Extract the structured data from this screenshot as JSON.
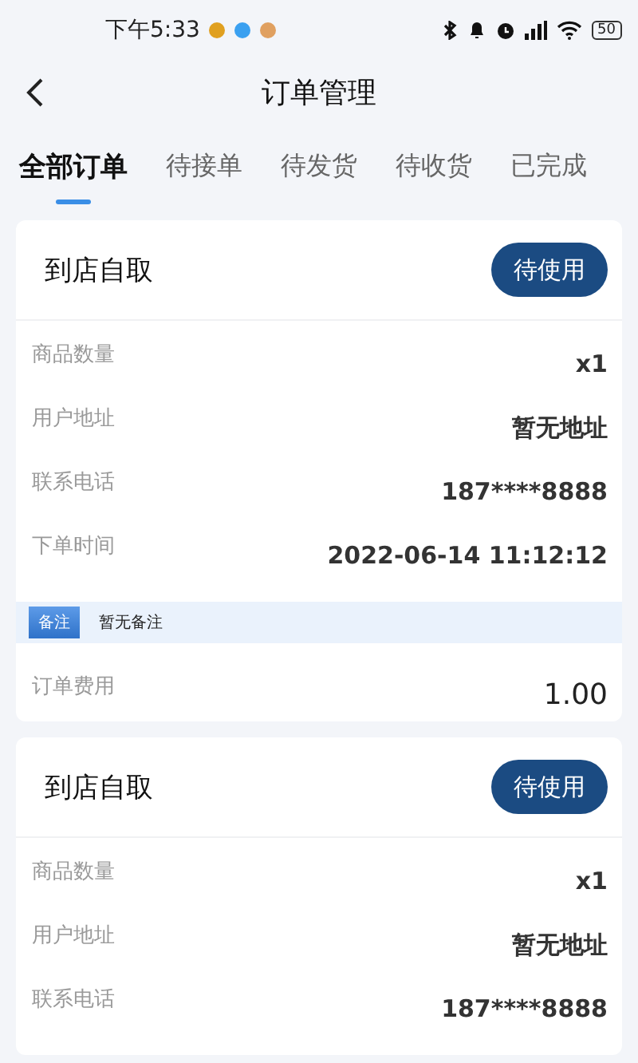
{
  "status_bar": {
    "time": "下午5:33",
    "battery": "50"
  },
  "header": {
    "title": "订单管理"
  },
  "tabs": [
    {
      "label": "全部订单",
      "selected": true
    },
    {
      "label": "待接单",
      "selected": false
    },
    {
      "label": "待发货",
      "selected": false
    },
    {
      "label": "待收货",
      "selected": false
    },
    {
      "label": "已完成",
      "selected": false
    }
  ],
  "orders": [
    {
      "type": "到店自取",
      "status": "待使用",
      "rows": [
        {
          "label": "商品数量",
          "value": "x1"
        },
        {
          "label": "用户地址",
          "value": "暂无地址"
        },
        {
          "label": "联系电话",
          "value": "187****8888"
        },
        {
          "label": "下单时间",
          "value": "2022-06-14 11:12:12"
        }
      ],
      "remark": {
        "tag": "备注",
        "text": "暂无备注"
      },
      "fee": {
        "label": "订单费用",
        "value": "1.00"
      }
    },
    {
      "type": "到店自取",
      "status": "待使用",
      "rows": [
        {
          "label": "商品数量",
          "value": "x1"
        },
        {
          "label": "用户地址",
          "value": "暂无地址"
        },
        {
          "label": "联系电话",
          "value": "187****8888"
        }
      ]
    }
  ]
}
